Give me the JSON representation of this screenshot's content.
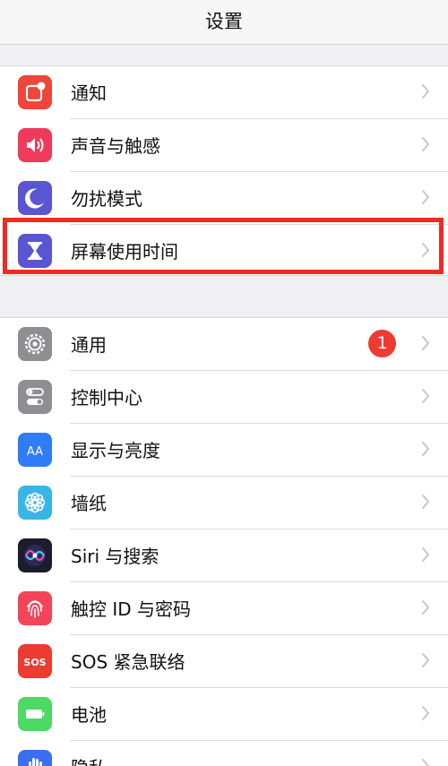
{
  "navbar": {
    "title": "设置"
  },
  "group1": [
    {
      "label": "通知",
      "icon": "notifications-icon",
      "color": "#f0453a"
    },
    {
      "label": "声音与触感",
      "icon": "speaker-icon",
      "color": "#ee3b5c"
    },
    {
      "label": "勿扰模式",
      "icon": "moon-icon",
      "color": "#5a55d2"
    },
    {
      "label": "屏幕使用时间",
      "icon": "hourglass-icon",
      "color": "#5a55d2"
    }
  ],
  "group2": [
    {
      "label": "通用",
      "icon": "gear-icon",
      "color": "#8e8e93",
      "badge": "1"
    },
    {
      "label": "控制中心",
      "icon": "toggles-icon",
      "color": "#8e8e93"
    },
    {
      "label": "显示与亮度",
      "icon": "text-size-icon",
      "color": "#2f7cf6",
      "icon_text": "AA"
    },
    {
      "label": "墙纸",
      "icon": "flower-icon",
      "color": "#38b5e8"
    },
    {
      "label": "Siri 与搜索",
      "icon": "siri-icon",
      "color": "#1c1c2e"
    },
    {
      "label": "触控 ID 与密码",
      "icon": "fingerprint-icon",
      "color": "#f2455a"
    },
    {
      "label": "SOS 紧急联络",
      "icon": "sos-icon",
      "color": "#ec3b30",
      "icon_text": "SOS"
    },
    {
      "label": "电池",
      "icon": "battery-icon",
      "color": "#4cd964"
    },
    {
      "label": "隐私",
      "icon": "hand-icon",
      "color": "#3a6ff2"
    }
  ],
  "colors": {
    "highlight": "#f12a1f",
    "chevron": "#c7c7cc"
  }
}
